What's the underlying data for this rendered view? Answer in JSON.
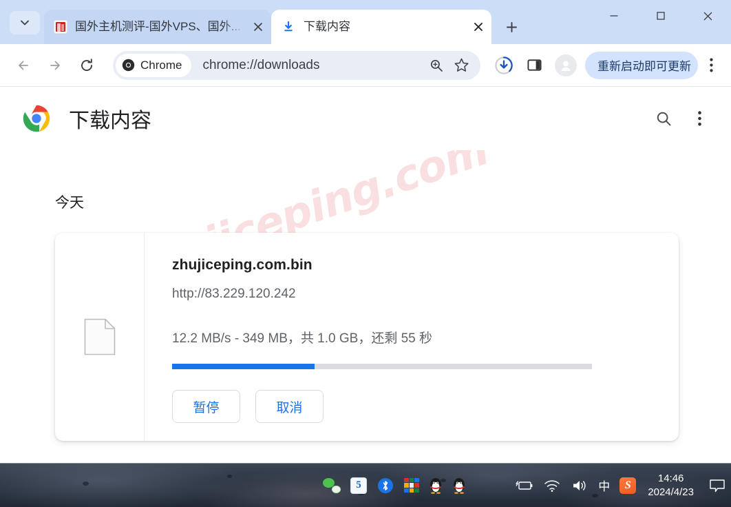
{
  "window": {
    "tabs": [
      {
        "title": "国外主机测评-国外VPS、国外...",
        "icon": "site-favicon",
        "active": false,
        "close_label": "×"
      },
      {
        "title": "下载内容",
        "icon": "download-icon",
        "active": true,
        "close_label": "×"
      }
    ],
    "new_tab_label": "+",
    "tab_search_label": "⌄",
    "controls": {
      "minimize": "—",
      "maximize": "▢",
      "close": "✕"
    }
  },
  "toolbar": {
    "back_label": "←",
    "forward_label": "→",
    "reload_label": "⟳",
    "chrome_chip_label": "Chrome",
    "url": "chrome://downloads",
    "zoom_icon": "zoom-search-icon",
    "bookmark_icon": "star-icon",
    "downloads_icon": "download-progress-icon",
    "sidepanel_icon": "side-panel-icon",
    "profile_icon": "avatar-icon",
    "update_label": "重新启动即可更新",
    "menu_label": "⋮"
  },
  "page": {
    "title": "下载内容",
    "search_label": "search-icon",
    "menu_label": "more-vertical-icon",
    "watermark": "zhujiceping.com",
    "group_label": "今天",
    "download": {
      "file_name": "zhujiceping.com.bin",
      "url": "http://83.229.120.242",
      "status": "12.2 MB/s - 349 MB，共 1.0 GB，还剩 55 秒",
      "progress_percent": 34,
      "speed": "12.2 MB/s",
      "downloaded": "349 MB",
      "total": "1.0 GB",
      "remaining": "55 秒",
      "pause_label": "暂停",
      "cancel_label": "取消"
    }
  },
  "taskbar": {
    "apps": [
      {
        "name": "wechat-icon"
      },
      {
        "name": "app-five-icon",
        "label": "5"
      },
      {
        "name": "bluetooth-icon"
      },
      {
        "name": "color-grid-icon"
      },
      {
        "name": "qq-icon"
      },
      {
        "name": "qq-icon-2"
      }
    ],
    "tray": [
      {
        "name": "battery-icon"
      },
      {
        "name": "wifi-icon"
      },
      {
        "name": "volume-icon"
      },
      {
        "name": "ime-chinese-icon",
        "label": "中"
      },
      {
        "name": "sogou-icon",
        "label": "S"
      }
    ],
    "clock_time": "14:46",
    "clock_date": "2024/4/23",
    "notification_icon": "notification-icon"
  },
  "colors": {
    "accent_blue": "#1a73e8",
    "tabstrip_bg": "#ccddf7",
    "inactive_tab": "#c3d6f4",
    "update_pill": "#d3e2fd",
    "progress_track": "#dadce0",
    "watermark_pink": "#fadfe0"
  }
}
